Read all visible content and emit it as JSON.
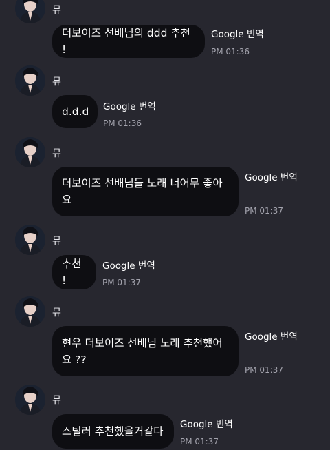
{
  "messages": [
    {
      "sender": "뮤",
      "text": "더보이즈 선배님의 ddd 추천 !",
      "translate": "Google 번역",
      "time": "PM 01:36"
    },
    {
      "sender": "뮤",
      "text": "d.d.d",
      "translate": "Google 번역",
      "time": "PM 01:36"
    },
    {
      "sender": "뮤",
      "text": "더보이즈 선배님들 노래 너어무 좋아\n요",
      "translate": "Google 번역",
      "time": "PM 01:37"
    },
    {
      "sender": "뮤",
      "text": "추천 !",
      "translate": "Google 번역",
      "time": "PM 01:37"
    },
    {
      "sender": "뮤",
      "text": "현우 더보이즈 선배님 노래 추천했어\n요 ??",
      "translate": "Google 번역",
      "time": "PM 01:37"
    },
    {
      "sender": "뮤",
      "text": "스틸러 추천했을거같다",
      "translate": "Google 번역",
      "time": "PM 01:37"
    }
  ]
}
